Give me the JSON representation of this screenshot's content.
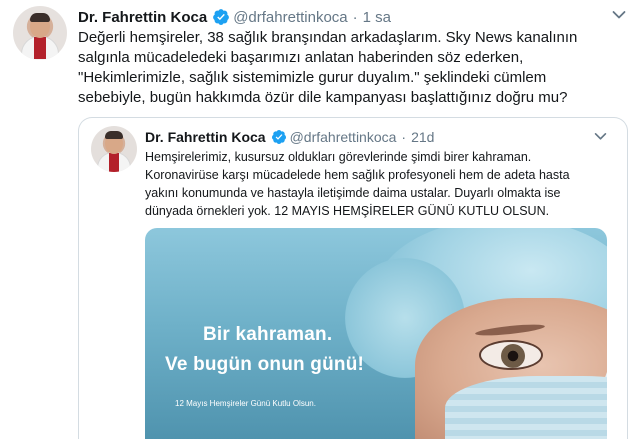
{
  "tweet": {
    "author_name": "Dr. Fahrettin Koca",
    "handle": "@drfahrettinkoca",
    "separator": "·",
    "time": "1 sa",
    "text_lines": [
      "Değerli hemşireler, 38 sağlık branşından arkadaşlarım. Sky News kanalının",
      "salgınla mücadeledeki başarımızı anlatan haberinden söz ederken,",
      "\"Hekimlerimizle, sağlık sistemimizle gurur duyalım.\" şeklindeki cümlem",
      "sebebiyle, bugün hakkımda özür dile kampanyası başlattığınız doğru mu?"
    ]
  },
  "quoted_tweet": {
    "author_name": "Dr. Fahrettin Koca",
    "handle": "@drfahrettinkoca",
    "separator": "·",
    "time": "21d",
    "text_lines": [
      "Hemşirelerimiz, kusursuz oldukları görevlerinde şimdi birer kahraman.",
      "Koronavirüse karşı mücadelede hem sağlık profesyoneli hem de adeta hasta",
      "yakını konumunda ve hastayla iletişimde daima ustalar. Duyarlı olmakta ise",
      "dünyada örnekleri yok. 12 MAYIS HEMŞİRELER GÜNÜ KUTLU OLSUN."
    ],
    "image": {
      "headline_line1": "Bir kahraman.",
      "headline_line2": "Ve bugün onun günü!",
      "small_text": "12 Mayıs Hemşireler Günü Kutlu Olsun."
    }
  },
  "icons": {
    "verified": "verified-badge-icon",
    "menu": "chevron-down-icon"
  },
  "colors": {
    "verified_blue": "#1da1f2",
    "secondary_text": "#657786",
    "border": "#d4dce2"
  }
}
